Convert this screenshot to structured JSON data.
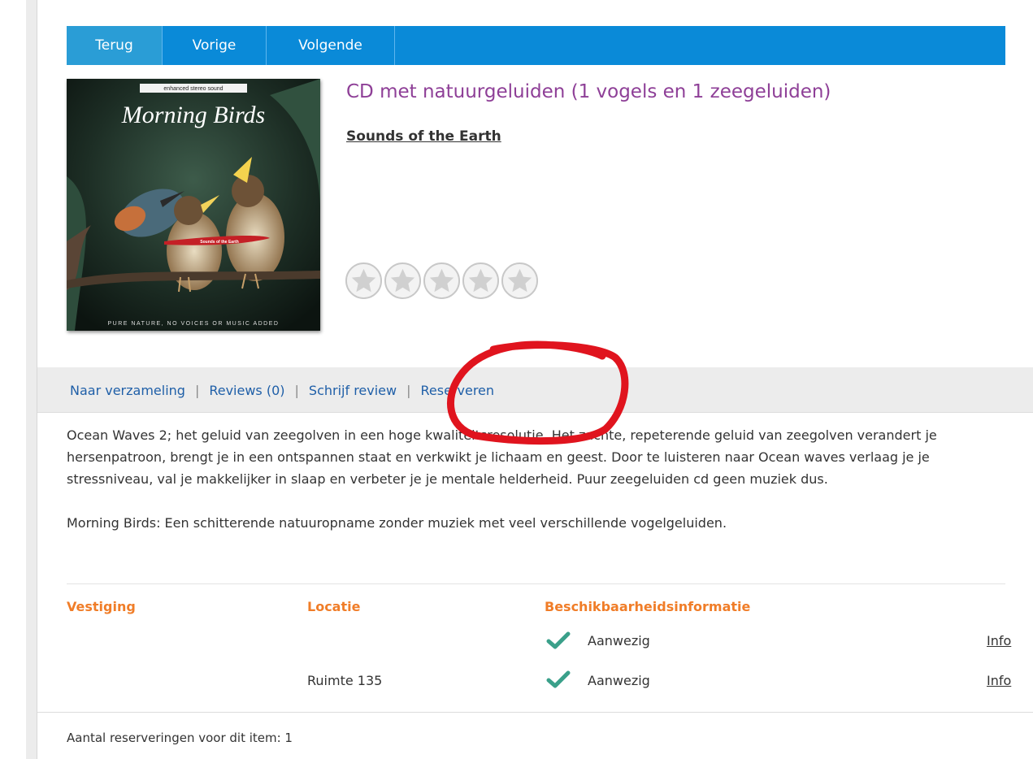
{
  "toolbar": {
    "back_label": "Terug",
    "prev_label": "Vorige",
    "next_label": "Volgende",
    "color": "#0a8ad8"
  },
  "item": {
    "title": "CD met natuurgeluiden (1 vogels en 1 zeegeluiden)",
    "author": "Sounds of the Earth",
    "rating_stars": 0,
    "rating_max": 5,
    "cover": {
      "top_text": "enhanced stereo sound",
      "title": "Morning Birds",
      "ribbon_text": "Sounds of the Earth",
      "bottom_text": "PURE NATURE, NO VOICES OR MUSIC ADDED"
    }
  },
  "actions": {
    "collection": "Naar verzameling",
    "reviews": "Reviews (0)",
    "write_review": "Schrijf review",
    "reserve": "Reserveren",
    "separator": "|"
  },
  "description": {
    "paragraph1": "Ocean Waves 2; het geluid van zeegolven in een hoge kwaliteitsresolutie. Het zachte, repeterende geluid van zeegolven verandert je hersenpatroon, brengt je in een ontspannen staat en verkwikt je lichaam en geest. Door te luisteren naar Ocean waves verlaag je je stressniveau, val je makkelijker in slaap en verbeter je je mentale helderheid. Puur zeegeluiden cd geen muziek dus.",
    "paragraph2": "Morning Birds: Een schitterende natuuropname zonder muziek met veel verschillende vogelgeluiden."
  },
  "availability": {
    "headers": {
      "branch": "Vestiging",
      "location": "Locatie",
      "status": "Beschikbaarheidsinformatie"
    },
    "rows": [
      {
        "branch": "",
        "location": "",
        "status": "Aanwezig",
        "link": "Info"
      },
      {
        "branch": "",
        "location": "Ruimte 135",
        "status": "Aanwezig",
        "link": "Info"
      }
    ],
    "header_color": "#f07d28",
    "check_color": "#3aa08a"
  },
  "footer": {
    "reservations": "Aantal reserveringen voor dit item: 1"
  },
  "annotation": {
    "color": "#e0141e"
  }
}
